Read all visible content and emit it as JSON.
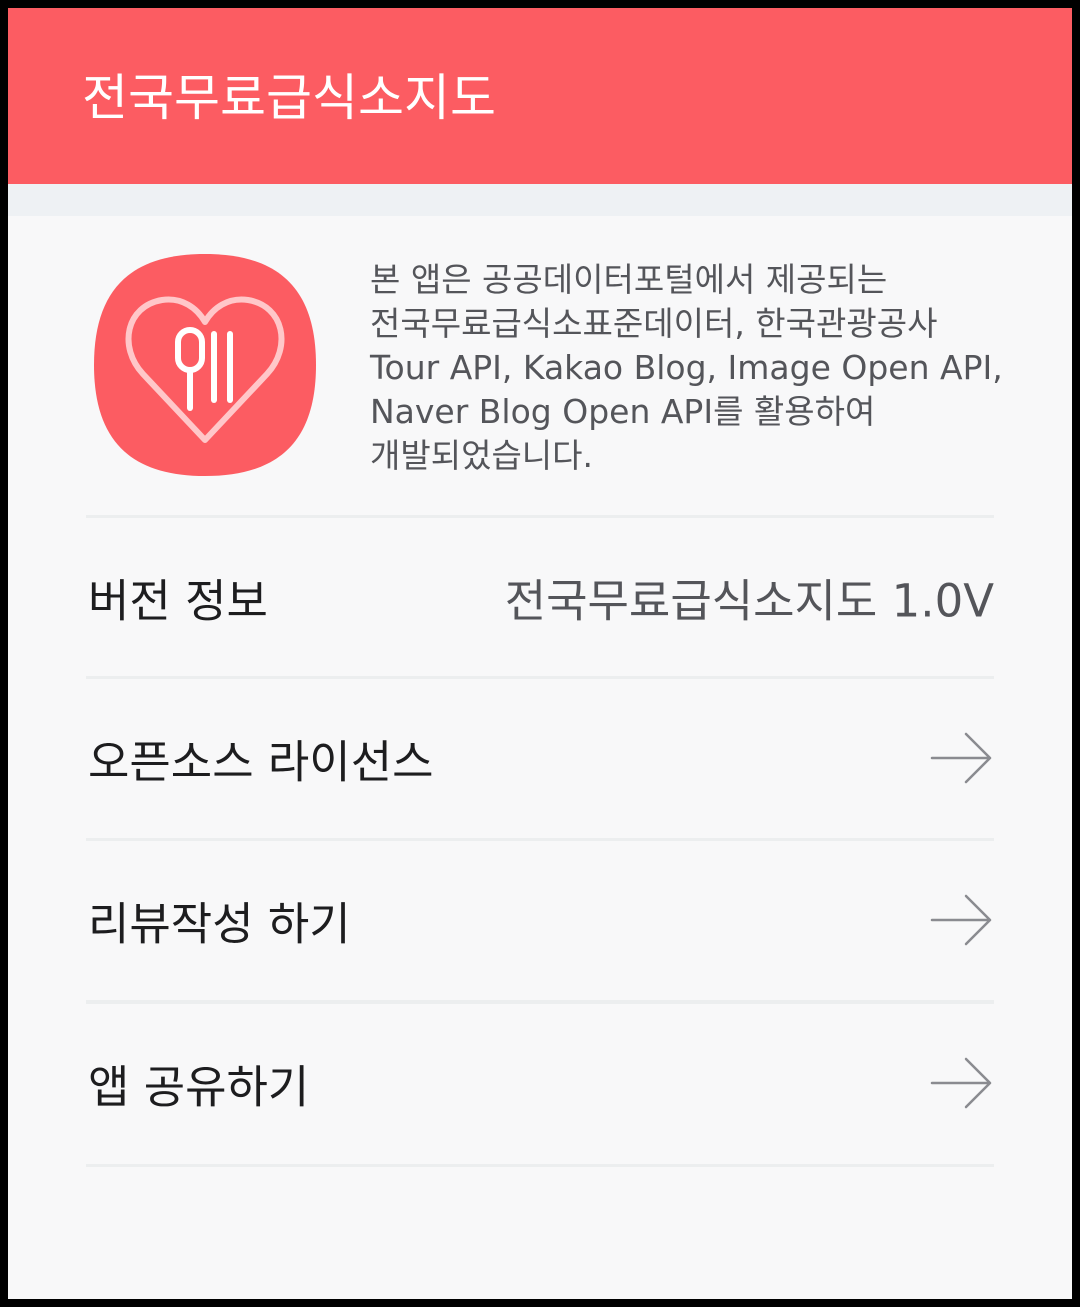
{
  "app_bar": {
    "title": "전국무료급식소지도",
    "color": "#fc5c62"
  },
  "about": {
    "icon": "heart-utensils-icon",
    "description": "본 앱은 공공데이터포털에서 제공되는\n전국무료급식소표준데이터, 한국관광공사\nTour API, Kakao Blog, Image Open API,\nNaver Blog Open API를 활용하여\n개발되었습니다."
  },
  "version": {
    "label": "버전 정보",
    "value": "전국무료급식소지도 1.0V"
  },
  "menu": {
    "items": [
      {
        "label": "오픈소스 라이선스",
        "icon": "arrow-right-icon"
      },
      {
        "label": "리뷰작성 하기",
        "icon": "arrow-right-icon"
      },
      {
        "label": "앱 공유하기",
        "icon": "arrow-right-icon"
      }
    ]
  }
}
